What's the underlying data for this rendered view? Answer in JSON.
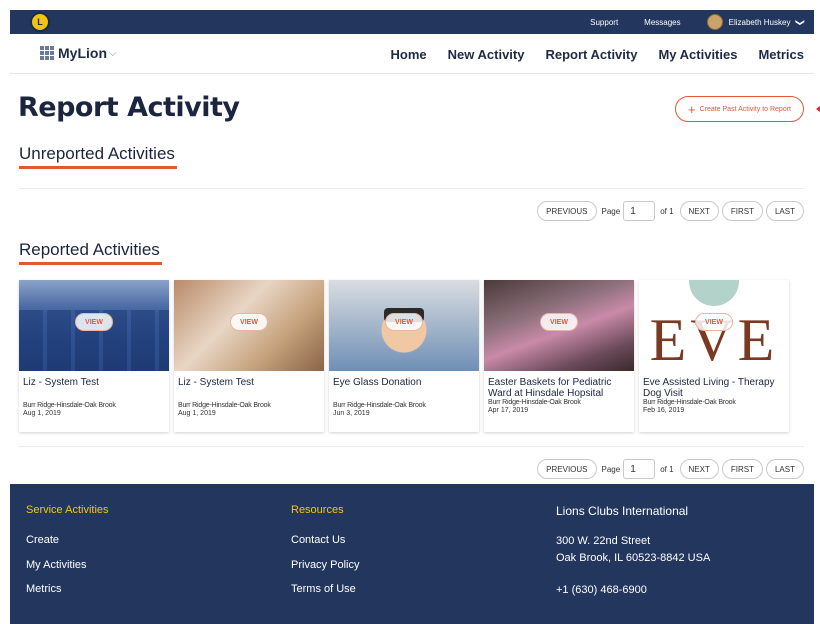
{
  "topbar": {
    "logo_text": "L",
    "support": "Support",
    "messages": "Messages",
    "user_name": "Elizabeth Huskey",
    "chevron": "❯"
  },
  "nav": {
    "brand": "MyLion",
    "brand_chevron": "⌵",
    "items": [
      "Home",
      "New Activity",
      "Report Activity",
      "My Activities",
      "Metrics"
    ]
  },
  "page": {
    "title": "Report Activity",
    "create_button": "Create Past Activity to Report",
    "create_icon": "+"
  },
  "unreported": {
    "title": "Unreported Activities"
  },
  "reported": {
    "title": "Reported Activities",
    "view_label": "VIEW",
    "cards": [
      {
        "title": "Liz - System Test",
        "club": "Burr Ridge-Hinsdale-Oak Brook",
        "date": "Aug 1, 2019"
      },
      {
        "title": "Liz - System Test",
        "club": "Burr Ridge-Hinsdale-Oak Brook",
        "date": "Aug 1, 2019"
      },
      {
        "title": "Eye Glass Donation",
        "club": "Burr Ridge-Hinsdale-Oak Brook",
        "date": "Jun 3, 2019"
      },
      {
        "title": "Easter Baskets for Pediatric Ward at Hinsdale Hopsital",
        "club": "Burr Ridge-Hinsdale-Oak Brook",
        "date": "Apr 17, 2019"
      },
      {
        "title": "Eve Assisted Living - Therapy Dog Visit",
        "club": "Burr Ridge-Hinsdale-Oak Brook",
        "date": "Feb 16, 2019"
      }
    ],
    "eve_logo_text": "EVE"
  },
  "pager": {
    "previous": "PREVIOUS",
    "page_label": "Page",
    "page_value": "1",
    "of_label": "of 1",
    "next": "NEXT",
    "first": "FIRST",
    "last": "LAST"
  },
  "footer": {
    "service_title": "Service Activities",
    "service_links": [
      "Create",
      "My Activities",
      "Metrics"
    ],
    "resources_title": "Resources",
    "resources_links": [
      "Contact Us",
      "Privacy Policy",
      "Terms of Use"
    ],
    "org_title": "Lions Clubs International",
    "address_line1": "300 W. 22nd Street",
    "address_line2": "Oak Brook, IL 60523-8842 USA",
    "phone": "+1 (630) 468-6900"
  },
  "colors": {
    "navy": "#23365e",
    "accent": "#e05a3a",
    "footer_heading": "#f5c518"
  }
}
